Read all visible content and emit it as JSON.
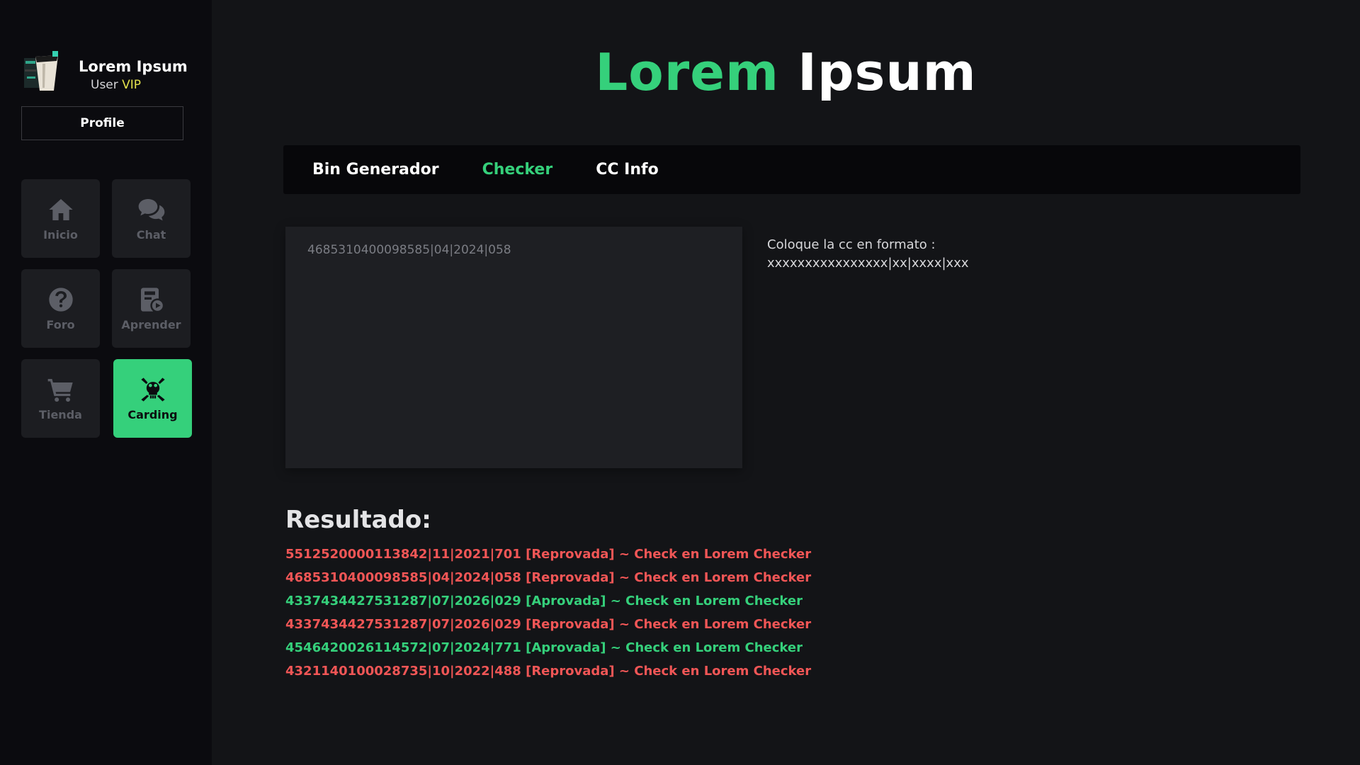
{
  "user": {
    "name": "Lorem Ipsum",
    "role_prefix": "User",
    "role_badge": "VIP",
    "profile_button": "Profile"
  },
  "nav": [
    {
      "label": "Inicio",
      "icon": "home-icon"
    },
    {
      "label": "Chat",
      "icon": "chat-icon"
    },
    {
      "label": "Foro",
      "icon": "help-icon"
    },
    {
      "label": "Aprender",
      "icon": "learn-icon"
    },
    {
      "label": "Tienda",
      "icon": "cart-icon"
    },
    {
      "label": "Carding",
      "icon": "skull-crossbones-icon",
      "active": true
    }
  ],
  "title": {
    "part1": "Lorem",
    "part2": "Ipsum"
  },
  "tabs": [
    {
      "label": "Bin Generador"
    },
    {
      "label": "Checker",
      "active": true
    },
    {
      "label": "CC Info"
    }
  ],
  "checker": {
    "placeholder": "4685310400098585|04|2024|058",
    "hint_line1": "Coloque la cc en formato :",
    "hint_line2": "xxxxxxxxxxxxxxxx|xx|xxxx|xxx"
  },
  "results": {
    "title": "Resultado:",
    "items": [
      {
        "text": "5512520000113842|11|2021|701 [Reprovada] ~ Check en Lorem Checker",
        "status": "Reprovada"
      },
      {
        "text": "4685310400098585|04|2024|058 [Reprovada] ~ Check en Lorem Checker",
        "status": "Reprovada"
      },
      {
        "text": "4337434427531287|07|2026|029 [Aprovada] ~ Check en Lorem Checker",
        "status": "Aprovada"
      },
      {
        "text": "4337434427531287|07|2026|029 [Reprovada] ~ Check en Lorem Checker",
        "status": "Reprovada"
      },
      {
        "text": "4546420026114572|07|2024|771 [Aprovada] ~ Check en Lorem Checker",
        "status": "Aprovada"
      },
      {
        "text": "4321140100028735|10|2022|488 [Reprovada] ~ Check en Lorem Checker",
        "status": "Reprovada"
      }
    ]
  },
  "colors": {
    "accent_green": "#35d07b",
    "error_red": "#f15656",
    "vip_yellow": "#e3e14c",
    "sidebar_bg": "#0b0b0f",
    "main_bg": "#131417"
  }
}
